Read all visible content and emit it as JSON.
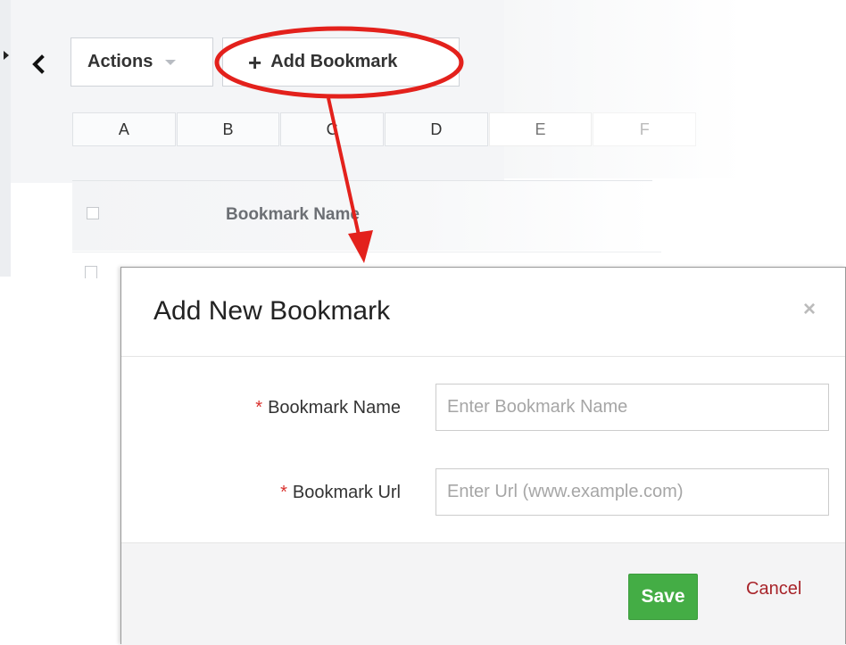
{
  "toolbar": {
    "back_icon": "chevron-left-icon",
    "actions_label": "Actions",
    "add_bookmark_label": "Add Bookmark",
    "add_icon": "plus-icon"
  },
  "alphabet_filter": [
    "A",
    "B",
    "C",
    "D",
    "E",
    "F"
  ],
  "table": {
    "column_header": "Bookmark Name"
  },
  "modal": {
    "title": "Add New Bookmark",
    "close_label": "×",
    "fields": {
      "name": {
        "required_marker": "*",
        "label": "Bookmark Name",
        "placeholder": "Enter Bookmark Name",
        "value": ""
      },
      "url": {
        "required_marker": "*",
        "label": "Bookmark Url",
        "placeholder": "Enter Url (www.example.com)",
        "value": ""
      }
    },
    "save_label": "Save",
    "cancel_label": "Cancel"
  },
  "colors": {
    "annotation_red": "#e3211c",
    "save_green": "#44ad45",
    "cancel_red": "#a8242a",
    "required_red": "#d9302c"
  }
}
